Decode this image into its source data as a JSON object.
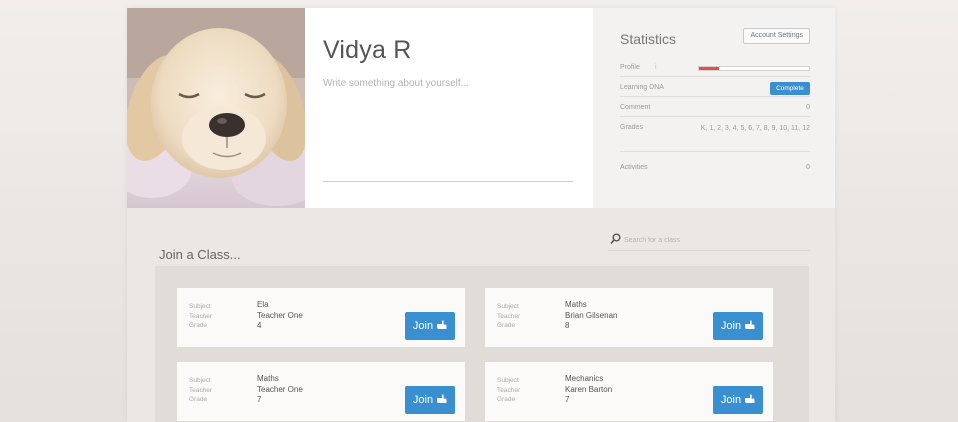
{
  "profile": {
    "name": "Vidya R",
    "bio_placeholder": "Write something about yourself..."
  },
  "stats": {
    "title": "Statistics",
    "account_settings_label": "Account Settings",
    "profile_label": "Profile",
    "profile_progress_fraction": 0.18,
    "learning_dna_label": "Learning DNA",
    "complete_label": "Complete",
    "comment_label": "Comment",
    "comment_value": "0",
    "grades_label": "Grades",
    "grades_value": "K, 1, 2, 3, 4, 5, 6, 7, 8, 9, 10, 11, 12",
    "activities_label": "Activities",
    "activities_value": "0"
  },
  "join": {
    "title": "Join a Class...",
    "search_placeholder": "Search for a class",
    "join_label": "Join",
    "field_labels": {
      "subject": "Subject",
      "teacher": "Teacher",
      "grade": "Grade"
    },
    "classes": [
      {
        "subject": "Ela",
        "teacher": "Teacher One",
        "grade": "4"
      },
      {
        "subject": "Maths",
        "teacher": "Brian Gilsenan",
        "grade": "8"
      },
      {
        "subject": "Maths",
        "teacher": "Teacher One",
        "grade": "7"
      },
      {
        "subject": "Mechanics",
        "teacher": "Karen Barton",
        "grade": "7"
      }
    ]
  },
  "colors": {
    "accent_blue": "#3a8fd1",
    "progress_red": "#d9534f"
  }
}
